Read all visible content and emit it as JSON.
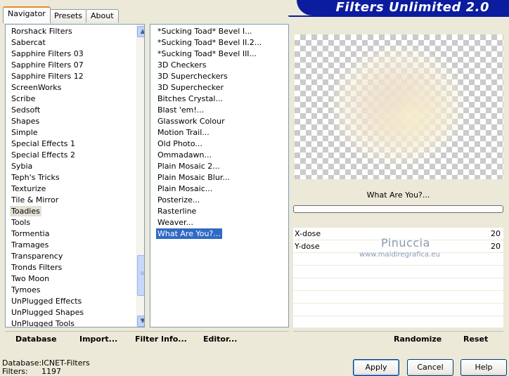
{
  "tabs": [
    {
      "label": "Navigator",
      "active": true
    },
    {
      "label": "Presets",
      "active": false
    },
    {
      "label": "About",
      "active": false
    }
  ],
  "banner": {
    "title": "Filters Unlimited 2.0"
  },
  "categories": {
    "items": [
      "Rorshack Filters",
      "Sabercat",
      "Sapphire Filters 03",
      "Sapphire Filters 07",
      "Sapphire Filters 12",
      "ScreenWorks",
      "Scribe",
      "Sedsoft",
      "Shapes",
      "Simple",
      "Special Effects 1",
      "Special Effects 2",
      "Sybia",
      "Teph's Tricks",
      "Texturize",
      "Tile & Mirror",
      "Toadies",
      "Tools",
      "Tormentia",
      "Tramages",
      "Transparency",
      "Tronds Filters",
      "Two Moon",
      "Tymoes",
      "UnPlugged Effects",
      "UnPlugged Shapes",
      "UnPlugged Tools"
    ],
    "selected": "Toadies"
  },
  "filters": {
    "items": [
      "*Sucking Toad*  Bevel I...",
      "*Sucking Toad*  Bevel II.2...",
      "*Sucking Toad*  Bevel III...",
      "3D Checkers",
      "3D Supercheckers",
      "3D Superchecker",
      "Bitches Crystal...",
      "Blast 'em!...",
      "Glasswork Colour",
      "Motion Trail...",
      "Old Photo...",
      "Ommadawn...",
      "Plain Mosaic 2...",
      "Plain Mosaic Blur...",
      "Plain Mosaic...",
      "Posterize...",
      "Rasterline",
      "Weaver...",
      "What Are You?..."
    ],
    "selected": "What Are You?..."
  },
  "scrollbar": {
    "up": "▲",
    "down": "▼"
  },
  "preview": {
    "filter_name": "What Are You?..."
  },
  "params": [
    {
      "label": "X-dose",
      "value": "20"
    },
    {
      "label": "Y-dose",
      "value": "20"
    }
  ],
  "watermark": {
    "name": "Pinuccia",
    "url": "www.maidiregrafica.eu"
  },
  "links_left": {
    "database": "Database",
    "import": "Import...",
    "filter_info": "Filter Info...",
    "editor": "Editor..."
  },
  "links_right": {
    "randomize": "Randomize",
    "reset": "Reset"
  },
  "status": {
    "database_key": "Database:",
    "database_value": "ICNET-Filters",
    "filters_key": "Filters:",
    "filters_value": "1197"
  },
  "buttons": {
    "apply": "Apply",
    "cancel": "Cancel",
    "help": "Help"
  },
  "colors": {
    "banner": "#0b1c9e",
    "selection": "#316ac5",
    "tab_highlight": "#e68b2c"
  }
}
